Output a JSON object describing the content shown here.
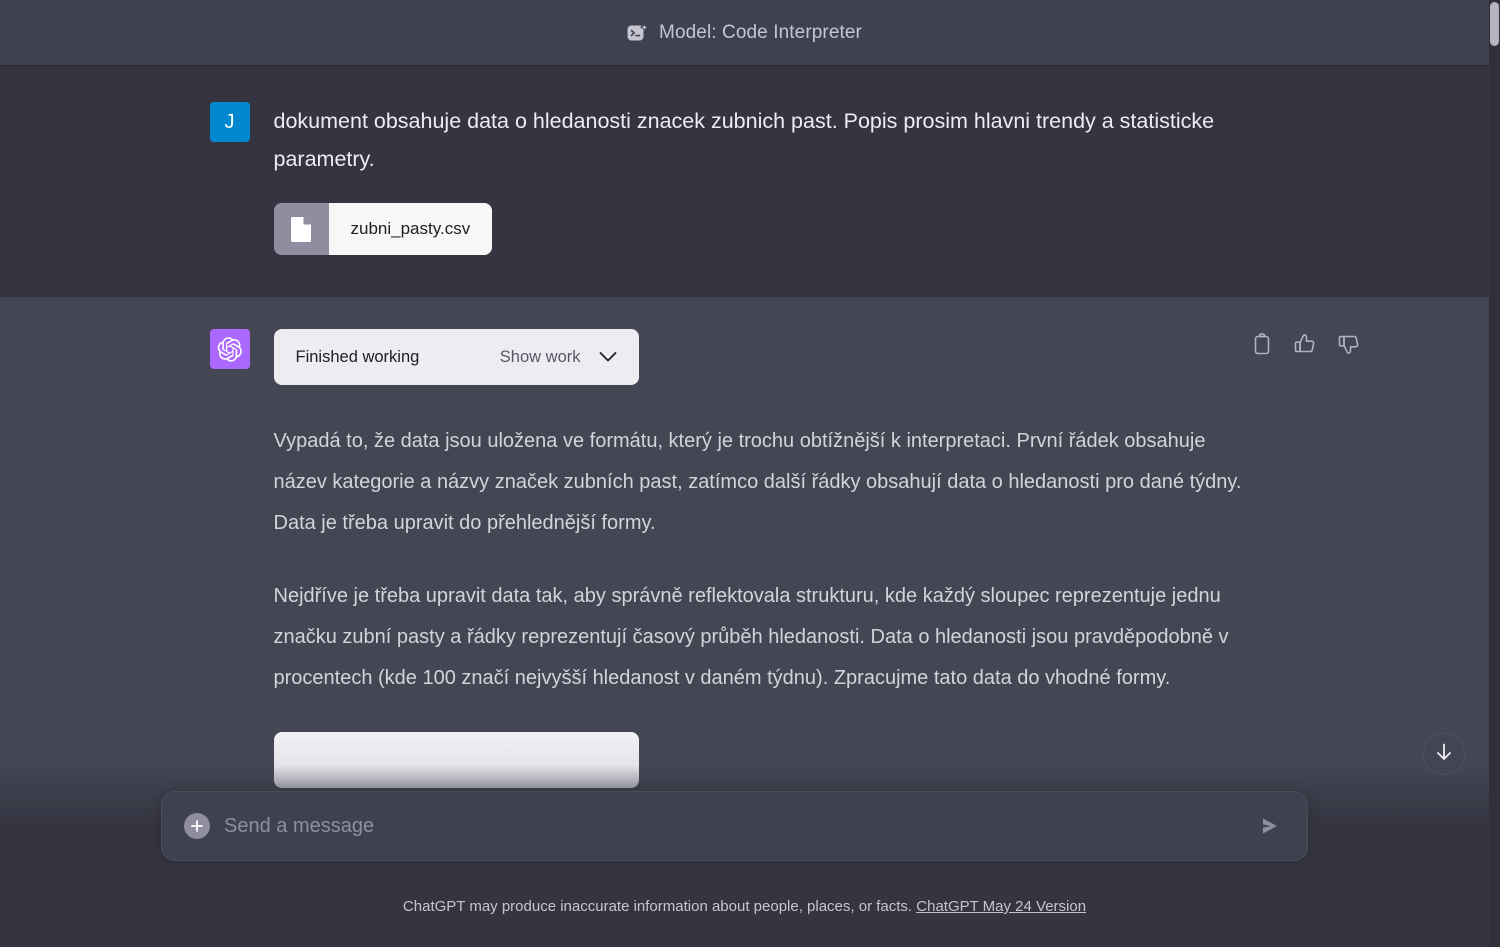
{
  "header": {
    "model_label": "Model: Code Interpreter",
    "model_icon": "code-interpreter-sparkle-icon"
  },
  "conversation": {
    "user_message": {
      "avatar_initial": "J",
      "text": "dokument obsahuje data o hledanosti znacek zubnich past. Popis prosim hlavni trendy a statisticke  parametry.",
      "attachment": {
        "filename": "zubni_pasty.csv",
        "icon": "file-document-icon"
      }
    },
    "assistant_message": {
      "avatar_icon": "openai-logo-icon",
      "tool_widget": {
        "status": "Finished working",
        "toggle_label": "Show work",
        "chevron": "chevron-down-icon"
      },
      "paragraphs": [
        "Vypadá to, že data jsou uložena ve formátu, který je trochu obtížnější k interpretaci. První řádek obsahuje název kategorie a názvy značek zubních past, zatímco další řádky obsahují data o hledanosti pro dané týdny. Data je třeba upravit do přehlednější formy.",
        "Nejdříve je třeba upravit data tak, aby správně reflektovala strukturu, kde každý sloupec reprezentuje jednu značku zubní pasty a řádky reprezentují časový průběh hledanosti. Data o hledanosti jsou pravděpodobně v procentech (kde 100 značí nejvyšší hledanost v daném týdnu). Zpracujme tato data do vhodné formy."
      ],
      "actions": [
        {
          "name": "copy-icon",
          "title": "Copy"
        },
        {
          "name": "thumbs-up-icon",
          "title": "Good response"
        },
        {
          "name": "thumbs-down-icon",
          "title": "Bad response"
        }
      ]
    }
  },
  "composer": {
    "placeholder": "Send a message",
    "value": "",
    "plus_icon": "plus-icon",
    "send_icon": "send-icon"
  },
  "footer": {
    "disclaimer": "ChatGPT may produce inaccurate information about people, places, or facts.",
    "version_link": "ChatGPT May 24 Version"
  },
  "controls": {
    "scroll_to_bottom_icon": "arrow-down-icon"
  },
  "colors": {
    "user_bg": "#343541",
    "assistant_bg": "#444654",
    "header_bg": "#40414f",
    "user_avatar": "#0288d1",
    "assistant_avatar": "#ab68ff",
    "widget_bg": "#ececf1",
    "text_primary": "#ececf1",
    "text_muted": "#c5c5d2"
  }
}
